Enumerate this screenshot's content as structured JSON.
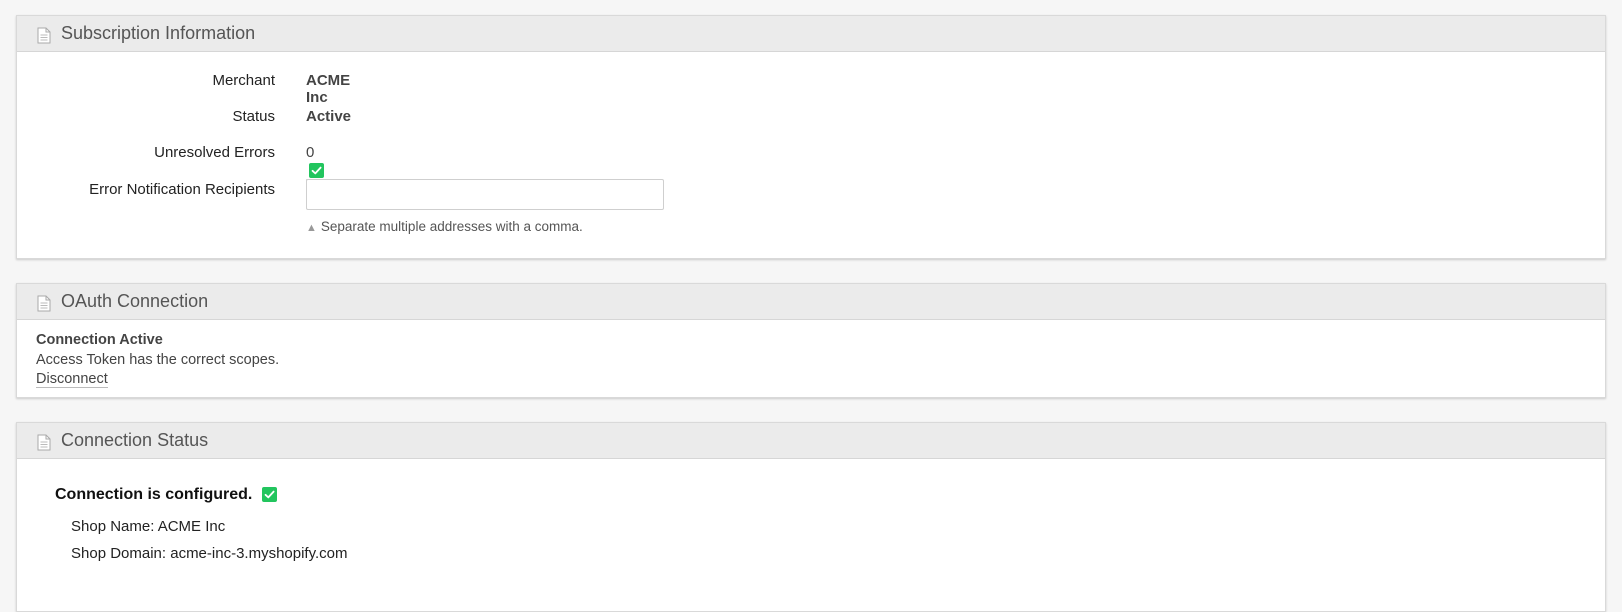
{
  "subscription": {
    "title": "Subscription Information",
    "merchant_label": "Merchant",
    "merchant_value": "ACME Inc",
    "status_label": "Status",
    "status_value": "Active",
    "errors_label": "Unresolved Errors",
    "errors_value": "0",
    "recipients_label": "Error Notification Recipients",
    "recipients_value": "",
    "recipients_help": "Separate multiple addresses with a comma."
  },
  "oauth": {
    "title": "OAuth Connection",
    "status_heading": "Connection Active",
    "status_text": "Access Token has the correct scopes.",
    "disconnect_label": "Disconnect"
  },
  "connection": {
    "title": "Connection Status",
    "configured_text": "Connection is configured.",
    "shop_name": "Shop Name: ACME Inc",
    "shop_domain": "Shop Domain: acme-inc-3.myshopify.com"
  },
  "colors": {
    "success": "#22c55e",
    "header_bg": "#ebebeb",
    "page_bg": "#f6f6f6"
  },
  "icons": {
    "panel_icon": "document-icon",
    "check_icon": "checkmark-icon"
  }
}
